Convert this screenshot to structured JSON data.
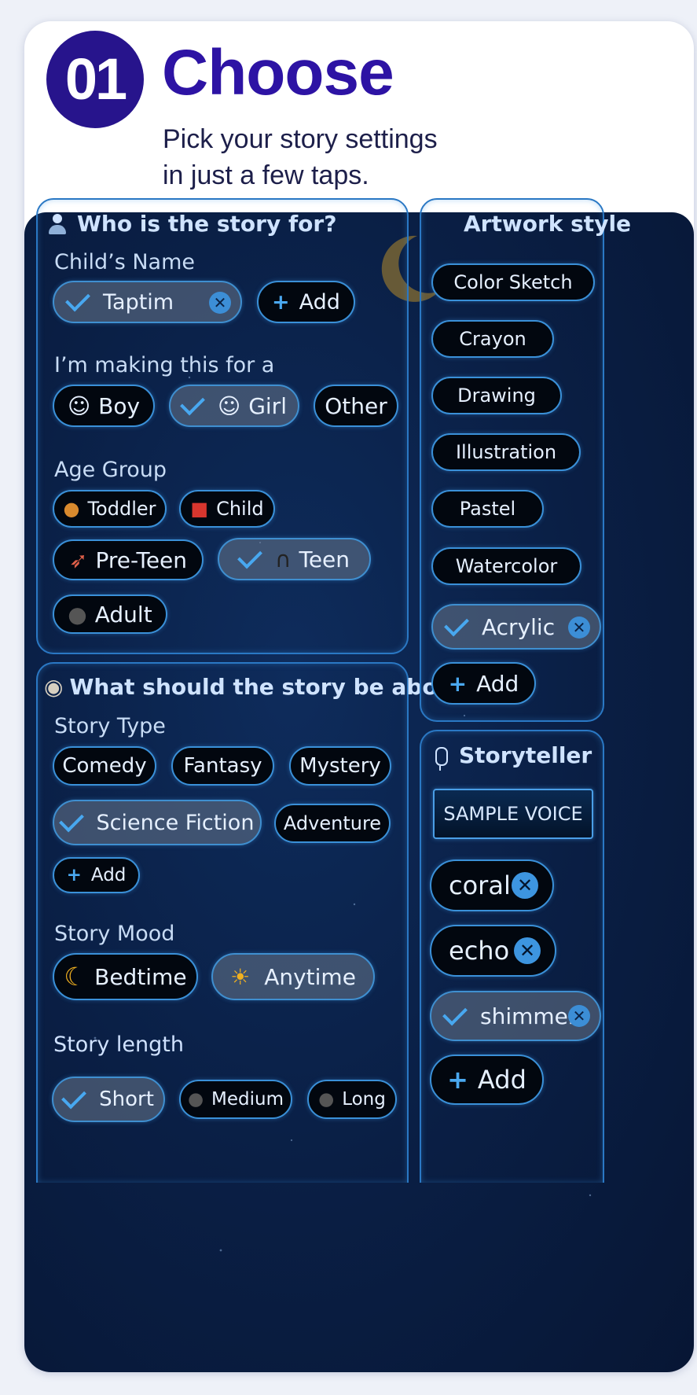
{
  "header": {
    "step_number": "01",
    "title": "Choose",
    "subtitle_line1": "Pick your story settings",
    "subtitle_line2": "in just a few taps."
  },
  "who": {
    "title": "Who is the story for?",
    "name_label": "Child’s Name",
    "name_chip": "Taptim",
    "add_label": "Add",
    "gender_label": "I’m making this for a",
    "genders": [
      "Boy",
      "Girl",
      "Other"
    ],
    "selected_gender": "Girl",
    "age_label": "Age Group",
    "ages": [
      "Toddler",
      "Child",
      "Pre-Teen",
      "Teen",
      "Adult"
    ],
    "selected_age": "Teen"
  },
  "about": {
    "title": "What should the story be about?",
    "type_label": "Story Type",
    "types": [
      "Comedy",
      "Fantasy",
      "Mystery",
      "Science Fiction",
      "Adventure"
    ],
    "selected_type": "Science Fiction",
    "add_label": "Add",
    "mood_label": "Story Mood",
    "moods": [
      "Bedtime",
      "Anytime"
    ],
    "selected_mood": "Anytime",
    "length_label": "Story length",
    "lengths": [
      "Short",
      "Medium",
      "Long"
    ],
    "selected_length": "Short"
  },
  "artwork": {
    "title": "Artwork style",
    "styles": [
      "Color Sketch",
      "Crayon",
      "Drawing",
      "Illustration",
      "Pastel",
      "Watercolor",
      "Acrylic"
    ],
    "selected_style": "Acrylic",
    "add_label": "Add"
  },
  "storyteller": {
    "title": "Storyteller",
    "sample_button": "SAMPLE VOICE",
    "voices": [
      "coral",
      "echo",
      "shimmer"
    ],
    "selected_voice": "shimmer",
    "add_label": "Add"
  },
  "icons": {
    "person": "person-icon",
    "palette": "palette-icon",
    "microphone": "microphone-icon",
    "moon": "moon-icon",
    "sun": "sun-icon"
  },
  "colors": {
    "brand": "#27148c",
    "title": "#2d13a4",
    "panel_bg": "#0a1f45",
    "chip_border": "#3a90d8",
    "accent": "#48a8f0"
  }
}
